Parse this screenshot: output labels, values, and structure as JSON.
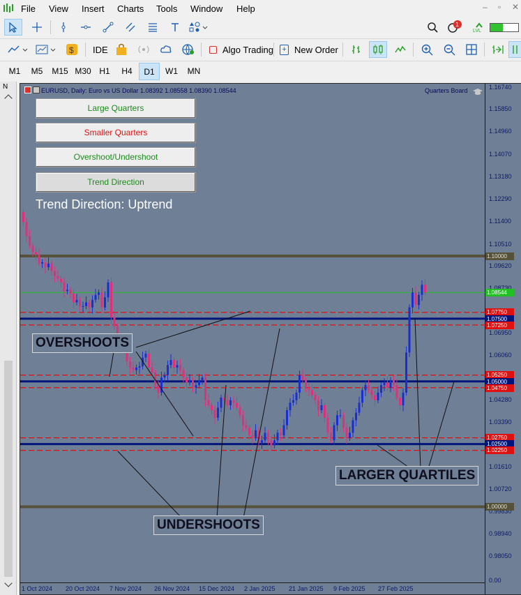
{
  "menu": {
    "items": [
      "File",
      "View",
      "Insert",
      "Charts",
      "Tools",
      "Window",
      "Help"
    ]
  },
  "toolbar": {
    "ide_label": "IDE",
    "algo_trading_label": "Algo Trading",
    "new_order_label": "New Order",
    "notification_count": "1",
    "lvl_label": "LVL"
  },
  "timeframes": [
    "M1",
    "M5",
    "M15",
    "M30",
    "H1",
    "H4",
    "D1",
    "W1",
    "MN"
  ],
  "active_timeframe": "D1",
  "chart": {
    "title": "EURUSD, Daily:  Euro vs US Dollar  1.08392 1.08558 1.08390 1.08544",
    "indicator_label": "Quarters Board",
    "trend_direction": "Trend Direction: Uptrend",
    "buttons": {
      "large_quarters": "Large Quarters",
      "smaller_quarters": "Smaller Quarters",
      "overshoot": "Overshoot/Undershoot",
      "trend": "Trend Direction"
    },
    "annotations": {
      "overshoots": "OVERSHOOTS",
      "undershoots": "UNDERSHOOTS",
      "larger_quartiles": "LARGER QUARTILES"
    },
    "y_labels": [
      "1.16740",
      "1.15850",
      "1.14960",
      "1.14070",
      "1.13180",
      "1.12290",
      "1.11400",
      "1.10510",
      "1.09620",
      "1.08730",
      "1.06950",
      "1.06060",
      "1.04280",
      "1.03390",
      "1.01610",
      "1.00720",
      "0.99830",
      "0.98940",
      "0.98050",
      "0.00"
    ],
    "level_tags": {
      "l110000": "1.10000",
      "current": "1.08544",
      "l107750": "1.07750",
      "l107500": "1.07500",
      "l107250": "1.07250",
      "l105250": "1.05250",
      "l105000": "1.05000",
      "l104750": "1.04750",
      "l102750": "1.02750",
      "l102500": "1.02500",
      "l102250": "1.02250",
      "l100000": "1.00000"
    },
    "x_labels": [
      "1 Oct 2024",
      "20 Oct 2024",
      "7 Nov 2024",
      "26 Nov 2024",
      "15 Dec 2024",
      "2 Jan 2025",
      "21 Jan 2025",
      "9 Feb 2025",
      "27 Feb 2025"
    ],
    "colors": {
      "background": "#6e7f96",
      "bull": "#1a2fd0",
      "bear": "#e0307a",
      "large_quarter": "#00157a",
      "small_quarter": "#e01010",
      "major_level": "#55513a",
      "current_price": "#22c022"
    }
  },
  "chart_data": {
    "type": "candlestick",
    "title": "EURUSD, Daily:  Euro vs US Dollar  1.08392 1.08558 1.08390 1.08544",
    "x_start": "1 Oct 2024",
    "x_end": "27 Feb 2025",
    "ylim": [
      0.975,
      1.17
    ],
    "levels": {
      "major": [
        1.1,
        1.0
      ],
      "large_quarters": [
        1.075,
        1.05,
        1.025
      ],
      "overshoot_undershoot": [
        1.0775,
        1.0725,
        1.0525,
        1.0475,
        1.0275,
        1.0225
      ],
      "current_price": 1.08544
    },
    "close": [
      1.1135,
      1.108,
      1.104,
      1.1015,
      1.1005,
      1.097,
      1.0975,
      1.0955,
      1.097,
      1.094,
      1.092,
      1.091,
      1.0895,
      1.086,
      1.0865,
      1.085,
      1.0815,
      1.0825,
      1.08,
      1.08,
      1.0815,
      1.0795,
      1.0825,
      1.0845,
      1.0855,
      1.0795,
      1.0835,
      1.0895,
      1.0755,
      1.072,
      1.0675,
      1.0645,
      1.0625,
      1.058,
      1.0555,
      1.0545,
      1.0555,
      1.056,
      1.0595,
      1.061,
      1.0555,
      1.0535,
      1.0485,
      1.0455,
      1.0515,
      1.0525,
      1.0565,
      1.0585,
      1.0555,
      1.0565,
      1.0545,
      1.0515,
      1.0495,
      1.0505,
      1.0475,
      1.0485,
      1.0505,
      1.0515,
      1.0425,
      1.0405,
      1.0385,
      1.0355,
      1.0395,
      1.0435,
      1.0425,
      1.0405,
      1.0425,
      1.0415,
      1.0395,
      1.0365,
      1.0325,
      1.0315,
      1.0285,
      1.0275,
      1.0305,
      1.0255,
      1.0265,
      1.0295,
      1.0265,
      1.0245,
      1.0265,
      1.0295,
      1.0285,
      1.0325,
      1.0385,
      1.0415,
      1.0425,
      1.0455,
      1.0525,
      1.0505,
      1.0475,
      1.0465,
      1.0445,
      1.0425,
      1.0385,
      1.0405,
      1.0355,
      1.0295,
      1.0265,
      1.0325,
      1.0365,
      1.0365,
      1.0315,
      1.0275,
      1.0295,
      1.0345,
      1.0375,
      1.0415,
      1.0465,
      1.0485,
      1.0465,
      1.0445,
      1.0425,
      1.0455,
      1.0485,
      1.0495,
      1.0475,
      1.0505,
      1.0485,
      1.0435,
      1.0405,
      1.0455,
      1.0615,
      1.0795,
      1.0855,
      1.0805,
      1.0845,
      1.0885,
      1.0854
    ]
  }
}
